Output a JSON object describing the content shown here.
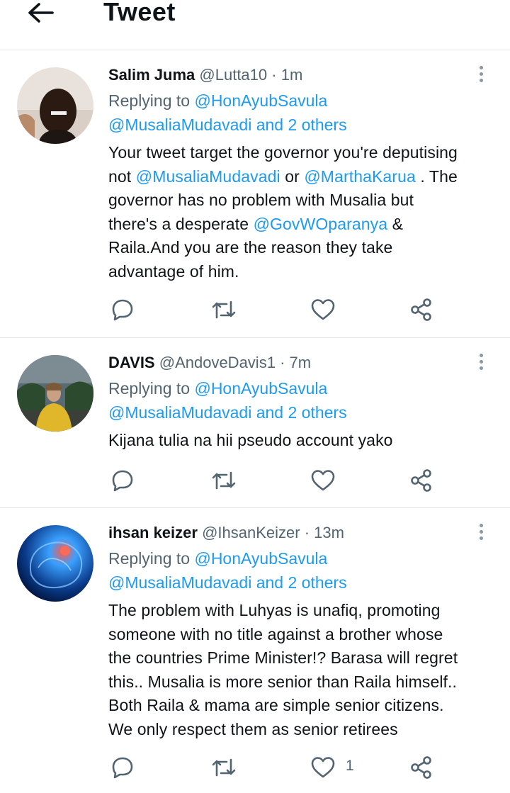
{
  "header": {
    "title": "Tweet"
  },
  "tweets": [
    {
      "name": "Salim Juma",
      "handle": "@Lutta10",
      "dot": "·",
      "time": "1m",
      "replying_prefix": "Replying to",
      "replying_to_1": "@HonAyubSavula",
      "replying_to_2": "@MusaliaMudavadi and 2 others",
      "body_lines": [
        [
          "Your tweet target the governor you're deputising"
        ],
        [
          "not ",
          {
            "link": "@MusaliaMudavadi"
          },
          " or ",
          {
            "link": "@MarthaKarua"
          },
          " . The"
        ],
        [
          "governor has no problem with Musalia but"
        ],
        [
          "there's a desperate ",
          {
            "link": "@GovWOparanya"
          },
          " &"
        ],
        [
          "Raila.And you are the reason they take"
        ],
        [
          "advantage of him."
        ]
      ],
      "like_count": ""
    },
    {
      "name": "DAVIS",
      "handle": "@AndoveDavis1",
      "dot": "·",
      "time": "7m",
      "replying_prefix": "Replying to",
      "replying_to_1": "@HonAyubSavula",
      "replying_to_2": "@MusaliaMudavadi and 2 others",
      "body_lines": [
        [
          "Kijana tulia na hii pseudo account yako"
        ]
      ],
      "like_count": ""
    },
    {
      "name": "ihsan keizer",
      "handle": "@IhsanKeizer",
      "dot": "·",
      "time": "13m",
      "replying_prefix": "Replying to",
      "replying_to_1": "@HonAyubSavula",
      "replying_to_2": "@MusaliaMudavadi and 2 others",
      "body_lines": [
        [
          "The problem with Luhyas is unafiq, promoting"
        ],
        [
          "someone with no title against a brother whose"
        ],
        [
          "the countries Prime Minister!? Barasa will regret"
        ],
        [
          "this.. Musalia is more senior than Raila himself.."
        ],
        [
          "Both  Raila & mama are simple senior citizens."
        ],
        [
          "We only respect them as senior retirees"
        ]
      ],
      "like_count": "1"
    }
  ],
  "icons": {
    "back": "arrow-left-icon",
    "more": "more-vertical-icon",
    "reply": "reply-icon",
    "retweet": "retweet-icon",
    "like": "heart-icon",
    "share": "share-icon"
  },
  "colors": {
    "link": "#1d9bf0",
    "secondary_text": "#536471",
    "divider": "#e3e6e8"
  }
}
